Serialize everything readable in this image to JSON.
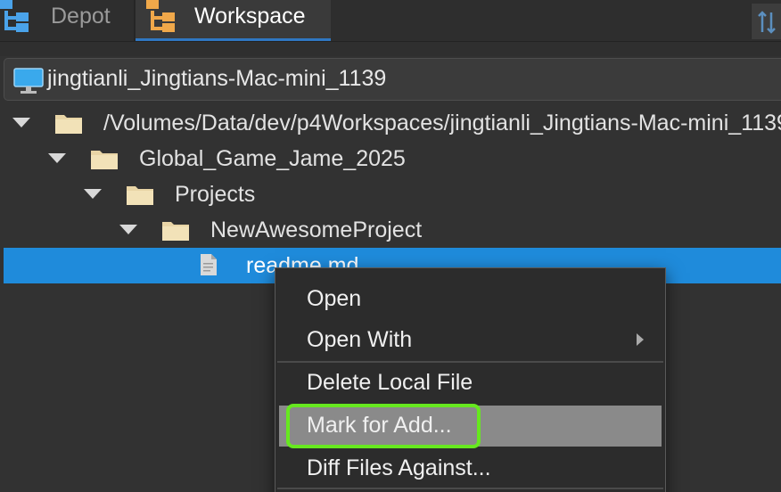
{
  "tabs": [
    {
      "label": "Depot",
      "icon": "depot-tree-icon",
      "active": false
    },
    {
      "label": "Workspace",
      "icon": "workspace-tree-icon",
      "active": true
    }
  ],
  "workspace_selector": {
    "icon": "monitor-icon",
    "name": "jingtianli_Jingtians-Mac-mini_1139"
  },
  "tree": [
    {
      "label": "/Volumes/Data/dev/p4Workspaces/jingtianli_Jingtians-Mac-mini_1139",
      "icon": "folder-icon",
      "expanded": true,
      "depth": 0
    },
    {
      "label": "Global_Game_Jame_2025",
      "icon": "folder-icon",
      "expanded": true,
      "depth": 1
    },
    {
      "label": "Projects",
      "icon": "folder-icon",
      "expanded": true,
      "depth": 2
    },
    {
      "label": "NewAwesomeProject",
      "icon": "folder-icon",
      "expanded": true,
      "depth": 3
    },
    {
      "label": "readme.md",
      "icon": "file-icon",
      "selected": true,
      "depth": 4
    }
  ],
  "context_menu": {
    "items": [
      {
        "label": "Open"
      },
      {
        "label": "Open With",
        "submenu": true
      },
      {
        "label": "Delete Local File"
      },
      {
        "label": "Mark for Add...",
        "highlighted": true
      },
      {
        "label": "Diff Files Against..."
      }
    ]
  },
  "colors": {
    "selection": "#1f8bdb",
    "highlight_outline": "#66e81f",
    "tab_accent": "#2f77c2",
    "folder": "#e9d5a6"
  }
}
